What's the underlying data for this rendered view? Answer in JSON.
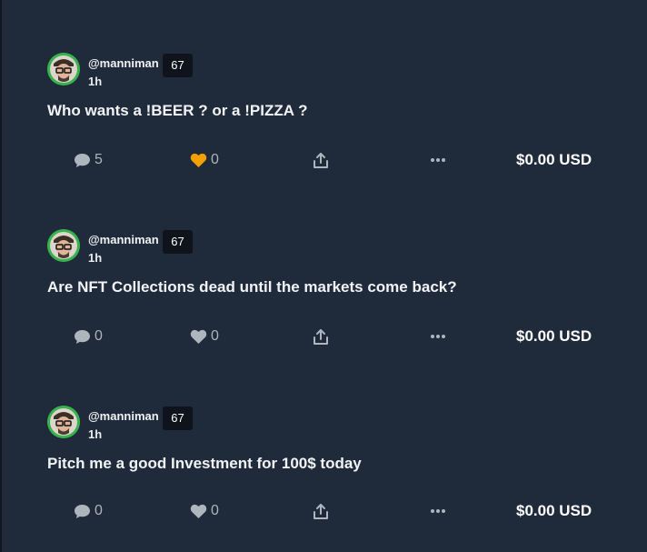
{
  "posts": [
    {
      "username": "@manniman",
      "reputation": "67",
      "time": "1h",
      "body": "Who wants a !BEER ? or a !PIZZA ?",
      "comments": "5",
      "likes": "0",
      "liked": true,
      "payout": "$0.00 USD"
    },
    {
      "username": "@manniman",
      "reputation": "67",
      "time": "1h",
      "body": "Are NFT Collections dead until the markets come back?",
      "comments": "0",
      "likes": "0",
      "liked": false,
      "payout": "$0.00 USD"
    },
    {
      "username": "@manniman",
      "reputation": "67",
      "time": "1h",
      "body": "Pitch me a good Investment for 100$ today",
      "comments": "0",
      "likes": "0",
      "liked": false,
      "payout": "$0.00 USD"
    }
  ],
  "icons": {
    "comment": "comment-icon",
    "like": "heart-icon",
    "share": "share-icon",
    "more": "more-icon"
  },
  "colors": {
    "background": "#1f2a3a",
    "liked_heart": "#f59f00",
    "icon_gray": "#adb5bd",
    "avatar_ring": "#37b24d"
  }
}
